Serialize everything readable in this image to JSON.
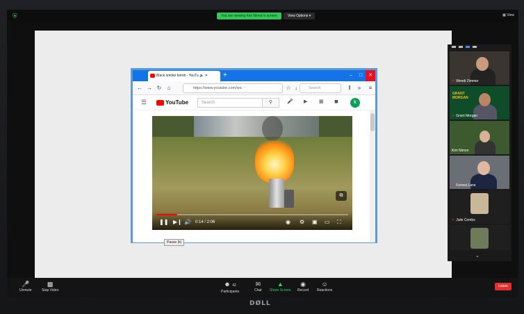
{
  "zoom_banner": {
    "viewing_text": "You are viewing Kim Nimon's screen",
    "view_options": "View Options",
    "view_button": "View"
  },
  "browser": {
    "tab_title": "Black smoke bomb - YouTu",
    "url": "https://www.youtube.com/wa",
    "search_placeholder": "Search"
  },
  "youtube": {
    "logo_text": "YouTube",
    "search_placeholder": "Search",
    "avatar_initial": "k",
    "video": {
      "time": "0:14 / 2:06",
      "progress": 0.11,
      "tooltip": "Pause (k)"
    }
  },
  "participants": [
    {
      "name": "Wendi Zimmer"
    },
    {
      "name": "Grant Morgan",
      "title_card": "GRANT MORGAN"
    },
    {
      "name": "Kim Nimon"
    },
    {
      "name": "Forrest Lane"
    },
    {
      "name": "Julie Combs"
    },
    {
      "name": ""
    }
  ],
  "toolbar": {
    "unmute": "Unmute",
    "stop_video": "Stop Video",
    "participants": "Participants",
    "participants_count": "42",
    "chat": "Chat",
    "share_screen": "Share Screen",
    "record": "Record",
    "reactions": "Reactions",
    "leave": "Leave"
  },
  "monitor_brand": "DØLL",
  "colors": {
    "zoom_green": "#34c759",
    "leave_red": "#e0312e",
    "browser_blue": "#1473e6",
    "youtube_red": "#ff0000"
  }
}
